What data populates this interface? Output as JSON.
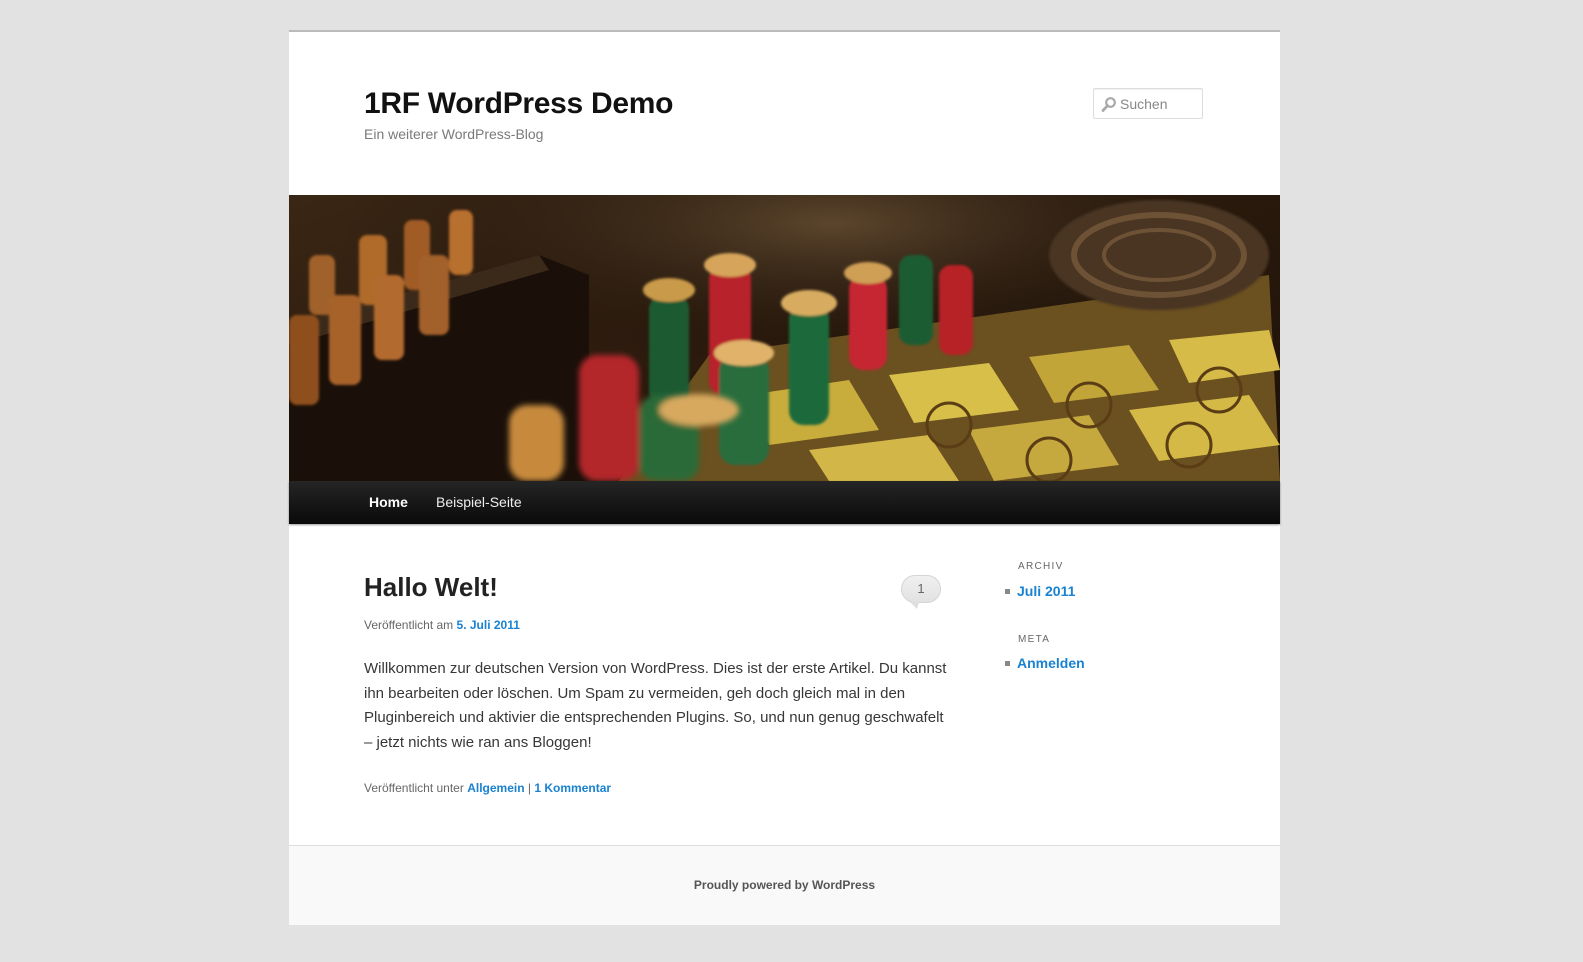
{
  "site": {
    "title": "1RF WordPress Demo",
    "description": "Ein weiterer WordPress-Blog"
  },
  "search": {
    "placeholder": "Suchen",
    "icon": "search-icon"
  },
  "header_image": {
    "icon": "chess-board-photo"
  },
  "nav": {
    "items": [
      {
        "label": "Home",
        "active": true
      },
      {
        "label": "Beispiel-Seite",
        "active": false
      }
    ]
  },
  "post": {
    "title": "Hallo Welt!",
    "comment_count": "1",
    "meta_prefix": "Veröffentlicht am",
    "date": "5. Juli 2011",
    "content": "Willkommen zur deutschen Version von WordPress. Dies ist der erste Artikel. Du kannst ihn bearbeiten oder löschen. Um Spam zu vermeiden, geh doch gleich mal in den Pluginbereich und aktivier die entsprechenden Plugins. So, und nun genug geschwafelt – jetzt nichts wie ran ans Bloggen!",
    "footer_prefix": "Veröffentlicht unter",
    "category": "Allgemein",
    "separator": "|",
    "comments_num": "1",
    "comments_label": "Kommentar"
  },
  "sidebar": {
    "archive": {
      "title": "ARCHIV",
      "items": [
        "Juli 2011"
      ]
    },
    "meta": {
      "title": "META",
      "items": [
        "Anmelden"
      ]
    }
  },
  "footer": {
    "text": "Proudly powered by WordPress"
  },
  "colors": {
    "link": "#1982d1",
    "nav_bg": "#0a0a0a",
    "page_bg": "#e2e2e2"
  }
}
